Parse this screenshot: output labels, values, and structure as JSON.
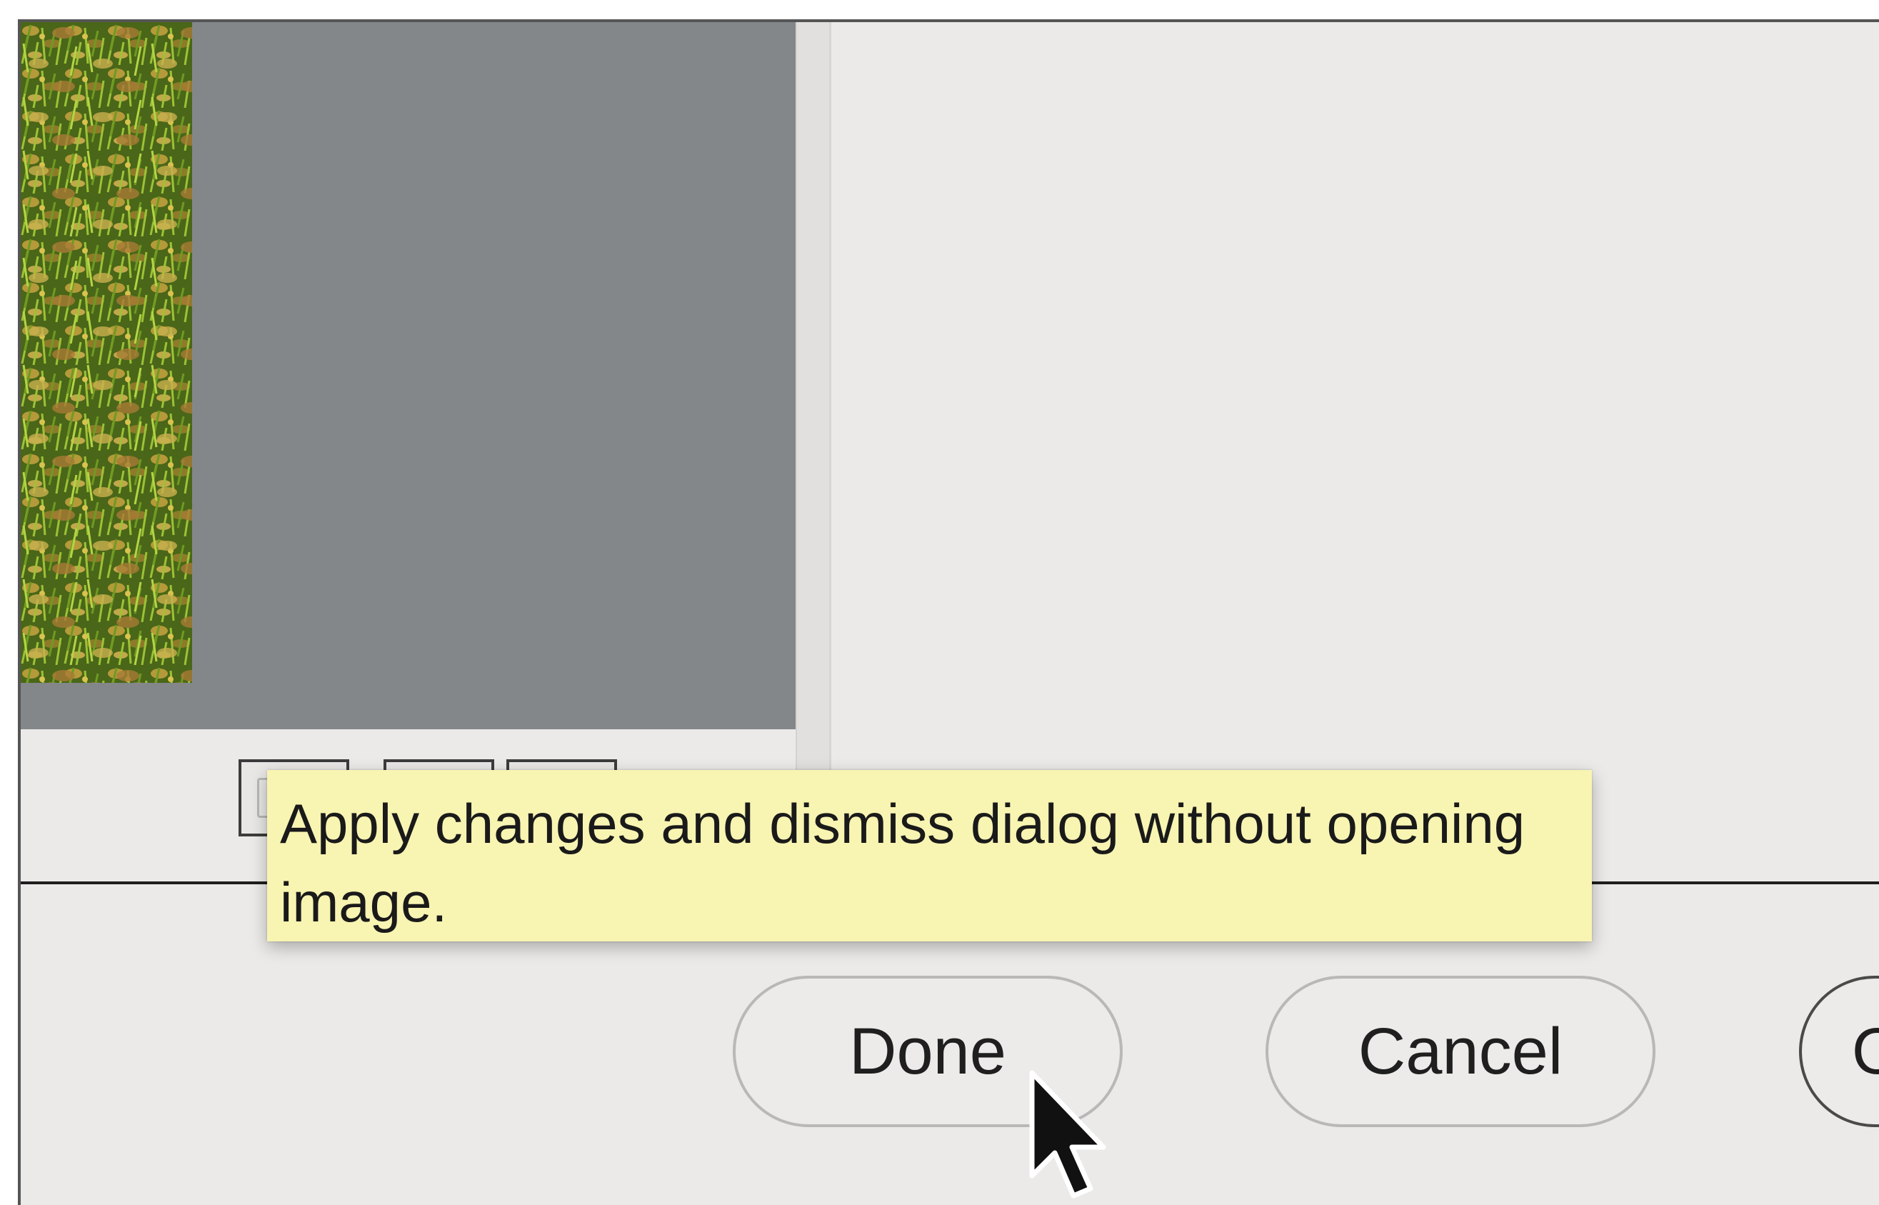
{
  "dialog": {
    "tooltip_text": "Apply changes and dismiss dialog without opening image.",
    "buttons": {
      "done_label": "Done",
      "cancel_label": "Cancel",
      "third_label_partial": "O"
    }
  },
  "preview": {
    "thumbnail_icon": "grass-photo-thumbnail",
    "view_buttons": [
      "single-view-icon",
      "before-after-icon",
      "split-view-icon"
    ]
  },
  "cursor_icon": "arrow-pointer-icon",
  "colors": {
    "tooltip_bg": "#f8f4b2",
    "preview_gray": "#848789",
    "dialog_bg": "#ebeae8"
  }
}
